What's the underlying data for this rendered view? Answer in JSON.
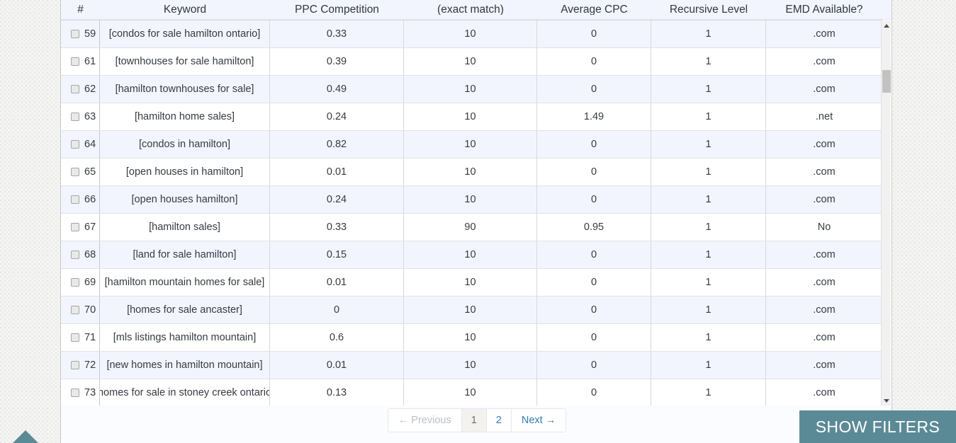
{
  "table": {
    "columns": [
      {
        "key": "index",
        "label": "#"
      },
      {
        "key": "keyword",
        "label": "Keyword"
      },
      {
        "key": "ppc",
        "label": "PPC Competition"
      },
      {
        "key": "exact",
        "label": "(exact match)"
      },
      {
        "key": "cpc",
        "label": "Average CPC"
      },
      {
        "key": "level",
        "label": "Recursive Level"
      },
      {
        "key": "emd",
        "label": "EMD Available?"
      }
    ],
    "rows": [
      {
        "index": "59",
        "keyword": "[condos for sale hamilton ontario]",
        "ppc": "0.33",
        "exact": "10",
        "cpc": "0",
        "level": "1",
        "emd": ".com"
      },
      {
        "index": "61",
        "keyword": "[townhouses for sale hamilton]",
        "ppc": "0.39",
        "exact": "10",
        "cpc": "0",
        "level": "1",
        "emd": ".com"
      },
      {
        "index": "62",
        "keyword": "[hamilton townhouses for sale]",
        "ppc": "0.49",
        "exact": "10",
        "cpc": "0",
        "level": "1",
        "emd": ".com"
      },
      {
        "index": "63",
        "keyword": "[hamilton home sales]",
        "ppc": "0.24",
        "exact": "10",
        "cpc": "1.49",
        "level": "1",
        "emd": ".net"
      },
      {
        "index": "64",
        "keyword": "[condos in hamilton]",
        "ppc": "0.82",
        "exact": "10",
        "cpc": "0",
        "level": "1",
        "emd": ".com"
      },
      {
        "index": "65",
        "keyword": "[open houses in hamilton]",
        "ppc": "0.01",
        "exact": "10",
        "cpc": "0",
        "level": "1",
        "emd": ".com"
      },
      {
        "index": "66",
        "keyword": "[open houses hamilton]",
        "ppc": "0.24",
        "exact": "10",
        "cpc": "0",
        "level": "1",
        "emd": ".com"
      },
      {
        "index": "67",
        "keyword": "[hamilton sales]",
        "ppc": "0.33",
        "exact": "90",
        "cpc": "0.95",
        "level": "1",
        "emd": "No"
      },
      {
        "index": "68",
        "keyword": "[land for sale hamilton]",
        "ppc": "0.15",
        "exact": "10",
        "cpc": "0",
        "level": "1",
        "emd": ".com"
      },
      {
        "index": "69",
        "keyword": "[hamilton mountain homes for sale]",
        "ppc": "0.01",
        "exact": "10",
        "cpc": "0",
        "level": "1",
        "emd": ".com"
      },
      {
        "index": "70",
        "keyword": "[homes for sale ancaster]",
        "ppc": "0",
        "exact": "10",
        "cpc": "0",
        "level": "1",
        "emd": ".com"
      },
      {
        "index": "71",
        "keyword": "[mls listings hamilton mountain]",
        "ppc": "0.6",
        "exact": "10",
        "cpc": "0",
        "level": "1",
        "emd": ".com"
      },
      {
        "index": "72",
        "keyword": "[new homes in hamilton mountain]",
        "ppc": "0.01",
        "exact": "10",
        "cpc": "0",
        "level": "1",
        "emd": ".com"
      },
      {
        "index": "73",
        "keyword": "[homes for sale in stoney creek ontario]",
        "ppc": "0.13",
        "exact": "10",
        "cpc": "0",
        "level": "1",
        "emd": ".com"
      }
    ]
  },
  "pagination": {
    "previous_label": "← Previous",
    "next_label": "Next →",
    "pages": [
      "1",
      "2"
    ],
    "active_page": "1"
  },
  "footer": {
    "show_filters_label": "SHOW FILTERS"
  },
  "colors": {
    "accent_teal": "#5b8a97",
    "row_alt": "#f2f5fd",
    "link_blue": "#337ab7"
  }
}
